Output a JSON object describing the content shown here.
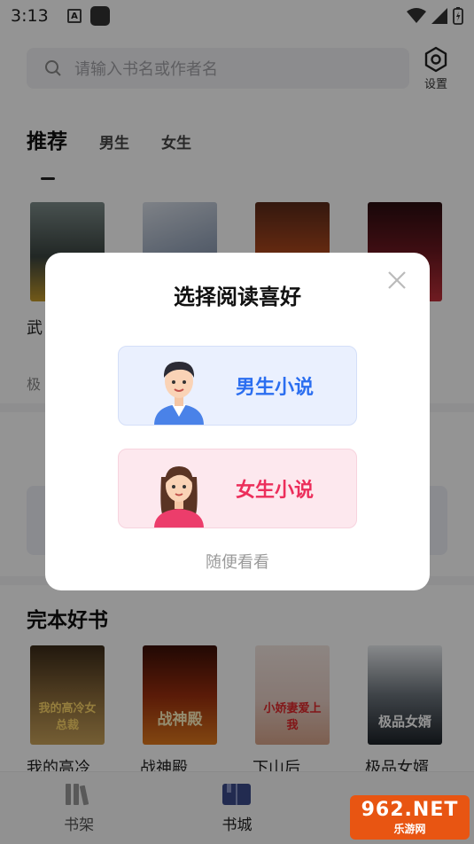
{
  "status_bar": {
    "time": "3:13",
    "badge": "A"
  },
  "header": {
    "search_placeholder": "请输入书名或作者名",
    "settings_label": "设置"
  },
  "tabs": [
    {
      "label": "推荐",
      "active": true
    },
    {
      "label": "男生",
      "active": false
    },
    {
      "label": "女生",
      "active": false
    }
  ],
  "recommend_books": [
    {
      "title": "武",
      "subtitle": "极"
    },
    {
      "title": "",
      "subtitle": ""
    },
    {
      "title": "",
      "subtitle": ""
    },
    {
      "title": "",
      "subtitle": ""
    }
  ],
  "finished_section": {
    "title": "完本好书",
    "books": [
      {
        "title": "我的高冷",
        "cover_text": "我的高冷女总裁"
      },
      {
        "title": "战神殿",
        "cover_text": "战神殿"
      },
      {
        "title": "下山后",
        "cover_text": "小娇妻爱上我"
      },
      {
        "title": "极品女婿",
        "cover_text": "极品女婿"
      }
    ]
  },
  "bottom_nav": [
    {
      "label": "书架",
      "active": false
    },
    {
      "label": "书城",
      "active": true
    },
    {
      "label": "",
      "active": false
    }
  ],
  "dialog": {
    "title": "选择阅读喜好",
    "male_option": "男生小说",
    "female_option": "女生小说",
    "skip": "随便看看"
  },
  "watermark": {
    "main": "962.NET",
    "sub": "乐游网"
  },
  "colors": {
    "male_accent": "#2b6ef0",
    "female_accent": "#ec2e5b",
    "nav_active": "#3c4a8a"
  }
}
